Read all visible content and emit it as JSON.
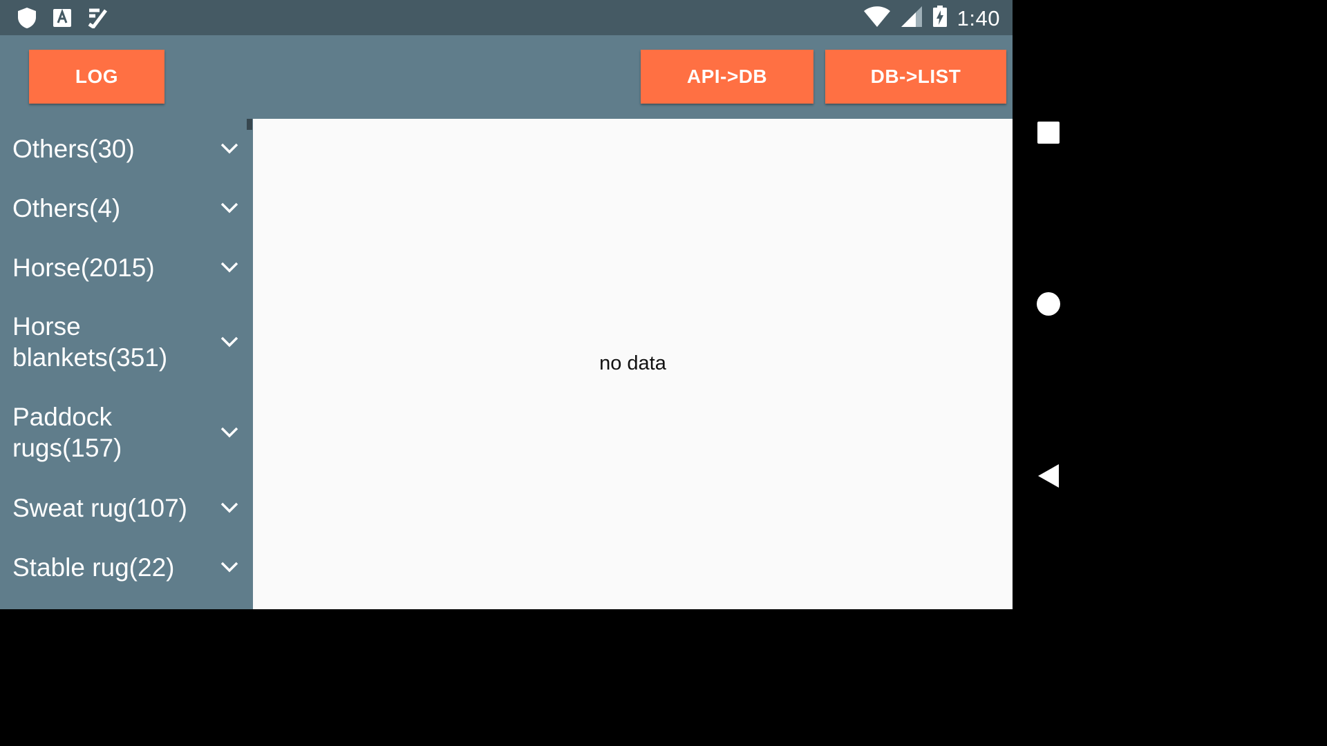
{
  "status_bar": {
    "time": "1:40",
    "left_icons": [
      "shield-icon",
      "text-a-icon",
      "checklist-icon"
    ],
    "right_icons": [
      "wifi-icon",
      "signal-icon",
      "battery-charging-icon"
    ]
  },
  "toolbar": {
    "log_label": "LOG",
    "api_db_label": "API->DB",
    "db_list_label": "DB->LIST"
  },
  "categories": [
    {
      "label": "Others(30)",
      "icon": "chevron-down-icon"
    },
    {
      "label": "Others(4)",
      "icon": "chevron-down-icon"
    },
    {
      "label": "Horse(2015)",
      "icon": "chevron-down-icon"
    },
    {
      "label": "Horse blankets(351)",
      "icon": "chevron-down-icon"
    },
    {
      "label": "Paddock rugs(157)",
      "icon": "chevron-down-icon"
    },
    {
      "label": "Sweat rug(107)",
      "icon": "chevron-down-icon"
    },
    {
      "label": "Stable rug(22)",
      "icon": "chevron-down-icon"
    }
  ],
  "content": {
    "empty_text": "no data"
  },
  "nav_bar": [
    "recents-square-icon",
    "home-circle-icon",
    "back-triangle-icon"
  ],
  "colors": {
    "status_bar": "#455a64",
    "app_background": "#607d8b",
    "accent_button": "#ff7043",
    "content_background": "#fafafa"
  }
}
